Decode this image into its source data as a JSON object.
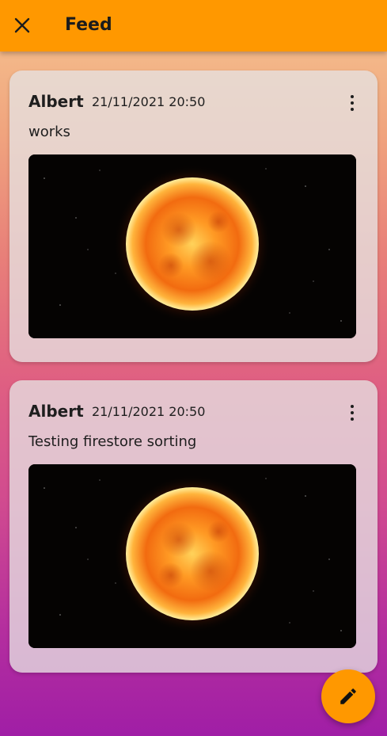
{
  "appbar": {
    "title": "Feed",
    "close_icon": "close-icon"
  },
  "posts": [
    {
      "author": "Albert",
      "date": "21/11/2021 20:50",
      "text": "works",
      "image": "sun-photo",
      "menu_icon": "more-vert-icon"
    },
    {
      "author": "Albert",
      "date": "21/11/2021 20:50",
      "text": "Testing firestore sorting",
      "image": "sun-photo",
      "menu_icon": "more-vert-icon"
    }
  ],
  "fab": {
    "icon": "edit-pencil-icon"
  },
  "colors": {
    "accent": "#ff9800",
    "text": "#1e1e1e"
  }
}
